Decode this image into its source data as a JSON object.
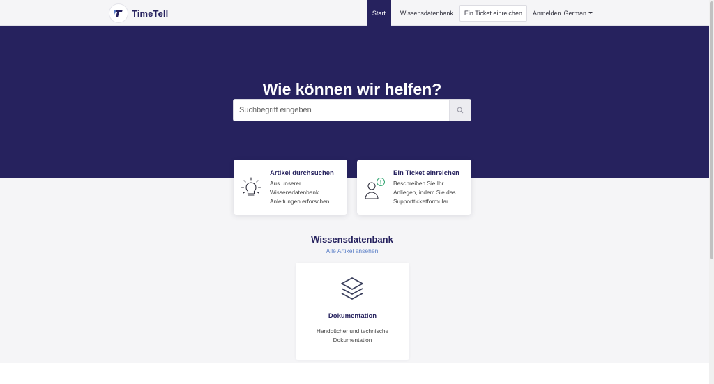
{
  "brand": {
    "name": "TimeTell"
  },
  "nav": {
    "items": [
      {
        "label": "Start",
        "active": true
      },
      {
        "label": "Wissensdatenbank"
      },
      {
        "label": "Ein Ticket einreichen"
      }
    ],
    "login": "Anmelden",
    "language": "German"
  },
  "hero": {
    "title": "Wie können wir helfen?",
    "search_placeholder": "Suchbegriff eingeben",
    "search_icon": "search-icon"
  },
  "cards": [
    {
      "title": "Artikel durchsuchen",
      "description": "Aus unserer Wissensdatenbank Anleitungen erforschen...",
      "icon": "lightbulb-icon"
    },
    {
      "title": "Ein Ticket einreichen",
      "description": "Beschreiben Sie Ihr Anliegen, indem Sie das Supportticketformular...",
      "icon": "person-alert-icon"
    }
  ],
  "knowledge_base": {
    "title": "Wissensdatenbank",
    "link": "Alle Artikel ansehen",
    "categories": [
      {
        "title": "Dokumentation",
        "description": "Handbücher und technische Dokumentation",
        "icon": "layers-icon"
      }
    ]
  },
  "colors": {
    "primary": "#26225e",
    "link": "#5b7fc7",
    "alert": "#3aa876"
  }
}
